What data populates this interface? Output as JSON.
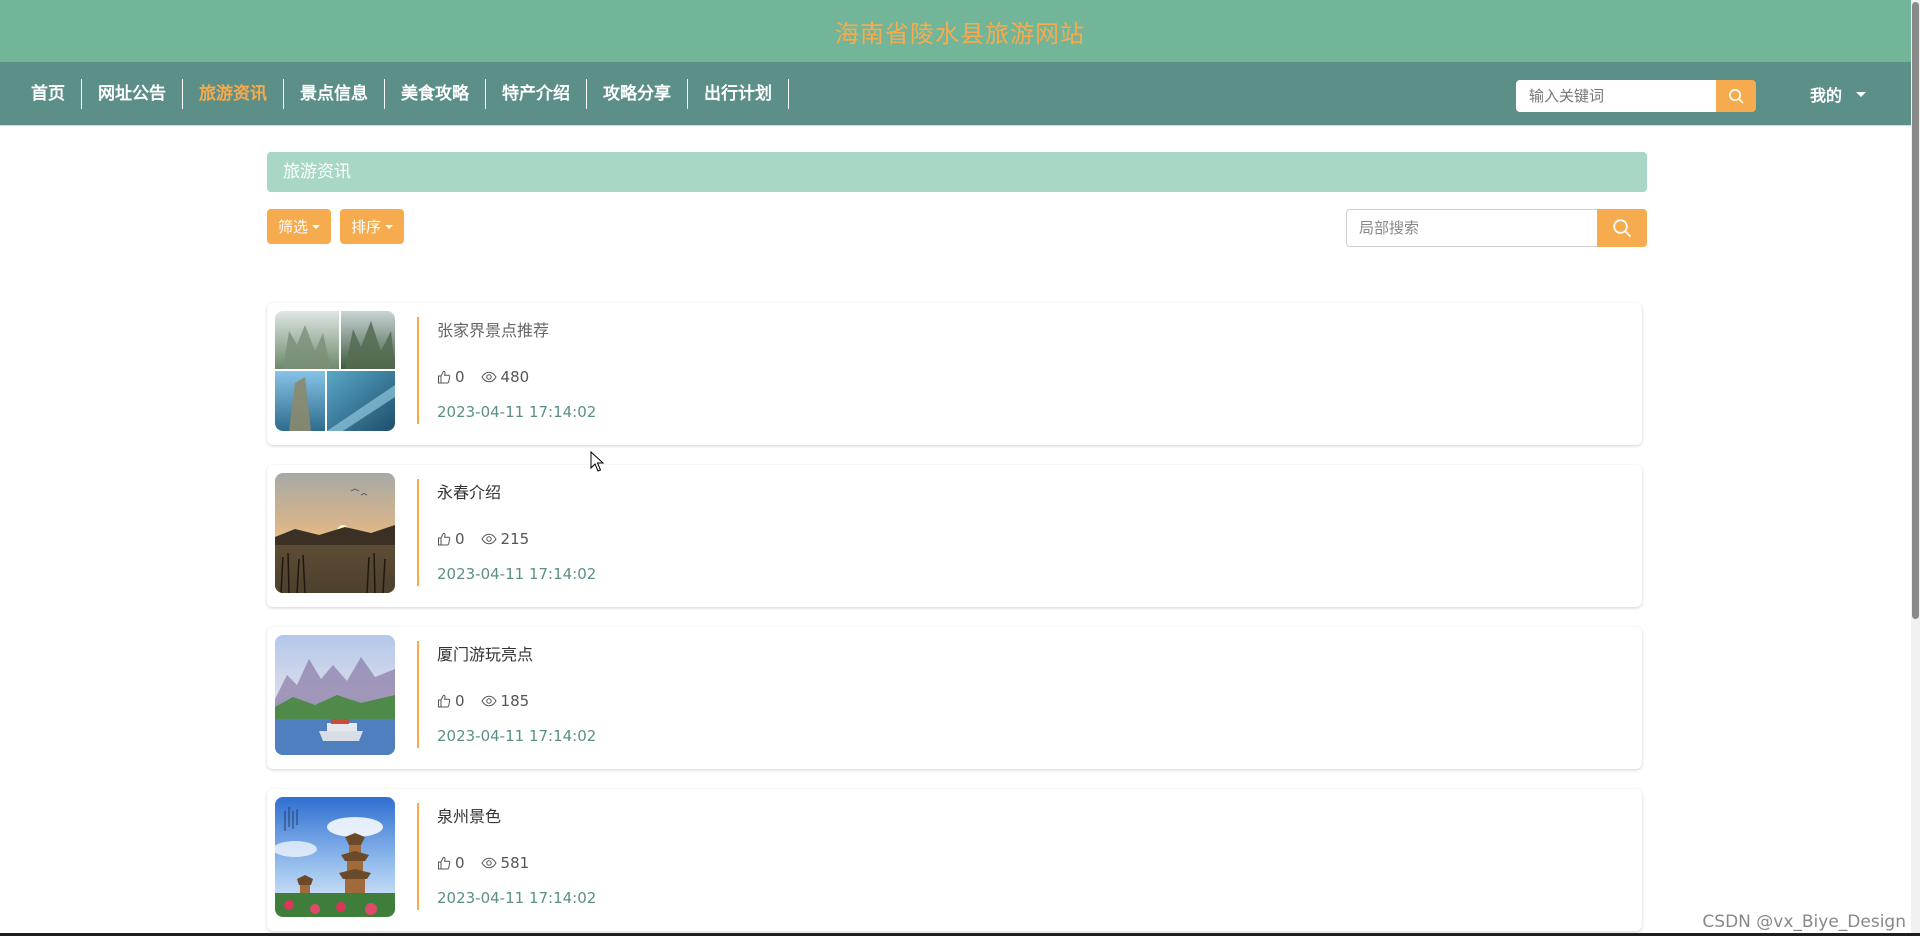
{
  "site": {
    "title": "海南省陵水县旅游网站"
  },
  "nav": {
    "items": [
      {
        "label": "首页"
      },
      {
        "label": "网址公告"
      },
      {
        "label": "旅游资讯"
      },
      {
        "label": "景点信息"
      },
      {
        "label": "美食攻略"
      },
      {
        "label": "特产介绍"
      },
      {
        "label": "攻略分享"
      },
      {
        "label": "出行计划"
      }
    ],
    "active_label": "旅游资讯",
    "search_placeholder": "输入关键词",
    "user_label": "我的"
  },
  "section": {
    "title": "旅游资讯"
  },
  "toolbar": {
    "filter_label": "筛选",
    "sort_label": "排序",
    "search_placeholder": "局部搜索"
  },
  "news": [
    {
      "title": "张家界景点推荐",
      "likes": "0",
      "views": "480",
      "time": "2023-04-11 17:14:02"
    },
    {
      "title": "永春介绍",
      "likes": "0",
      "views": "215",
      "time": "2023-04-11 17:14:02"
    },
    {
      "title": "厦门游玩亮点",
      "likes": "0",
      "views": "185",
      "time": "2023-04-11 17:14:02"
    },
    {
      "title": "泉州景色",
      "likes": "0",
      "views": "581",
      "time": "2023-04-11 17:14:02"
    }
  ],
  "icons": {
    "search": "search-icon",
    "like": "thumb-up-icon",
    "view": "eye-icon",
    "dropdown": "caret-down-icon"
  },
  "colors": {
    "header_bg": "#73b599",
    "nav_bg": "#5b8f88",
    "accent": "#f6ab4e",
    "section_bar": "#a8d8c5",
    "time_text": "#5b8f88"
  },
  "watermark": "CSDN @vx_Biye_Design"
}
